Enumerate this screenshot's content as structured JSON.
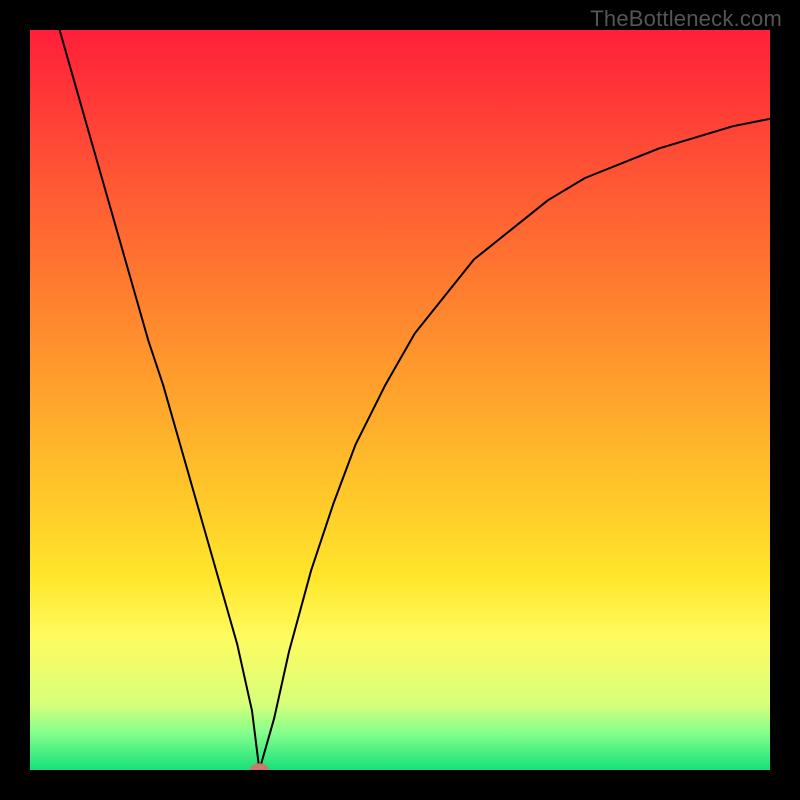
{
  "watermark": "TheBottleneck.com",
  "chart_data": {
    "type": "line",
    "title": "",
    "xlabel": "",
    "ylabel": "",
    "xlim": [
      0,
      100
    ],
    "ylim": [
      0,
      100
    ],
    "grid": false,
    "legend": false,
    "background_type": "vertical_gradient_red_to_green",
    "gradient_stops": [
      {
        "offset": 0.0,
        "color": "#ff1f3a"
      },
      {
        "offset": 0.2,
        "color": "#ff5634"
      },
      {
        "offset": 0.4,
        "color": "#ff8a2e"
      },
      {
        "offset": 0.6,
        "color": "#ffc02a"
      },
      {
        "offset": 0.74,
        "color": "#ffe62b"
      },
      {
        "offset": 0.82,
        "color": "#fffb60"
      },
      {
        "offset": 0.91,
        "color": "#d8ff7a"
      },
      {
        "offset": 0.95,
        "color": "#84ff8c"
      },
      {
        "offset": 1.0,
        "color": "#16e07a"
      }
    ],
    "series": [
      {
        "name": "bottleneck-curve",
        "x": [
          4,
          6,
          8,
          10,
          12,
          14,
          16,
          18,
          20,
          22,
          24,
          26,
          28,
          30,
          31,
          33,
          35,
          38,
          41,
          44,
          48,
          52,
          56,
          60,
          65,
          70,
          75,
          80,
          85,
          90,
          95,
          100
        ],
        "y": [
          100,
          93,
          86,
          79,
          72,
          65,
          58,
          52,
          45,
          38,
          31,
          24,
          17,
          8,
          0,
          7,
          16,
          27,
          36,
          44,
          52,
          59,
          64,
          69,
          73,
          77,
          80,
          82,
          84,
          85.5,
          87,
          88
        ],
        "style": {
          "stroke": "#000000",
          "stroke_width": 2
        }
      }
    ],
    "markers": [
      {
        "name": "optimum-point",
        "x": 31,
        "y": 0,
        "shape": "ellipse",
        "rx": 1.3,
        "ry": 0.9,
        "fill": "#c97c6a"
      }
    ]
  }
}
